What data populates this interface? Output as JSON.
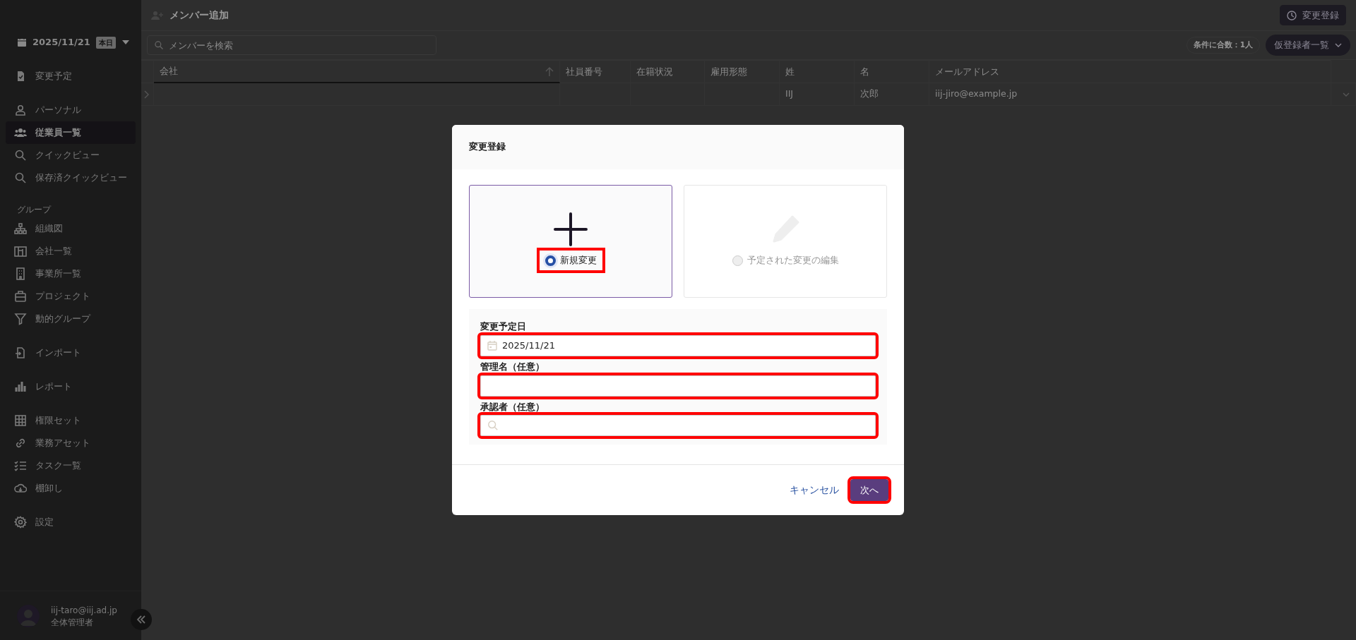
{
  "sidebar": {
    "date": "2025/11/21",
    "date_badge": "本日",
    "groups": [
      {
        "items": [
          {
            "label": "変更予定",
            "selected": false
          }
        ]
      },
      {
        "items": [
          {
            "label": "パーソナル",
            "selected": false
          },
          {
            "label": "従業員一覧",
            "selected": true
          },
          {
            "label": "クイックビュー",
            "selected": false
          },
          {
            "label": "保存済クイックビュー",
            "selected": false
          }
        ]
      },
      {
        "heading": "グループ",
        "items": [
          {
            "label": "組織図",
            "selected": false
          },
          {
            "label": "会社一覧",
            "selected": false
          },
          {
            "label": "事業所一覧",
            "selected": false
          },
          {
            "label": "プロジェクト",
            "selected": false
          },
          {
            "label": "動的グループ",
            "selected": false
          }
        ]
      },
      {
        "items": [
          {
            "label": "インポート",
            "selected": false
          }
        ]
      },
      {
        "items": [
          {
            "label": "レポート",
            "selected": false
          }
        ]
      },
      {
        "items": [
          {
            "label": "権限セット",
            "selected": false
          },
          {
            "label": "業務アセット",
            "selected": false
          },
          {
            "label": "タスク一覧",
            "selected": false
          },
          {
            "label": "棚卸し",
            "selected": false
          }
        ]
      },
      {
        "items": [
          {
            "label": "設定",
            "selected": false
          }
        ]
      }
    ],
    "user": {
      "email": "iij-taro@iij.ad.jp",
      "role": "全体管理者"
    }
  },
  "topbar": {
    "title": "メンバー追加",
    "action": "変更登録"
  },
  "toolbar": {
    "search_placeholder": "メンバーを検索",
    "count": "条件に合数：1人",
    "list_button": "仮登録者一覧"
  },
  "table": {
    "columns": [
      {
        "label": "会社",
        "sorted": true
      },
      {
        "label": "社員番号",
        "sorted": false
      },
      {
        "label": "在籍状況",
        "sorted": false
      },
      {
        "label": "雇用形態",
        "sorted": false
      },
      {
        "label": "姓",
        "sorted": false
      },
      {
        "label": "名",
        "sorted": false
      },
      {
        "label": "メールアドレス",
        "sorted": false
      }
    ],
    "rows": [
      {
        "cells": [
          "",
          "",
          "",
          "",
          "IIJ",
          "次郎",
          "iij-jiro@example.jp"
        ]
      }
    ]
  },
  "modal": {
    "title": "変更登録",
    "options": [
      {
        "label": "新規変更",
        "selected": true,
        "highlighted": true
      },
      {
        "label": "予定された変更の編集",
        "selected": false,
        "highlighted": false
      }
    ],
    "fields": [
      {
        "label": "変更予定日",
        "kind": "date",
        "value": "2025/11/21",
        "highlighted": true
      },
      {
        "label": "管理名（任意）",
        "kind": "text",
        "highlighted": true
      },
      {
        "label": "承認者（任意）",
        "kind": "search",
        "highlighted": true
      }
    ],
    "cancel": "キャンセル",
    "next": {
      "label": "次へ",
      "highlighted": true
    }
  }
}
